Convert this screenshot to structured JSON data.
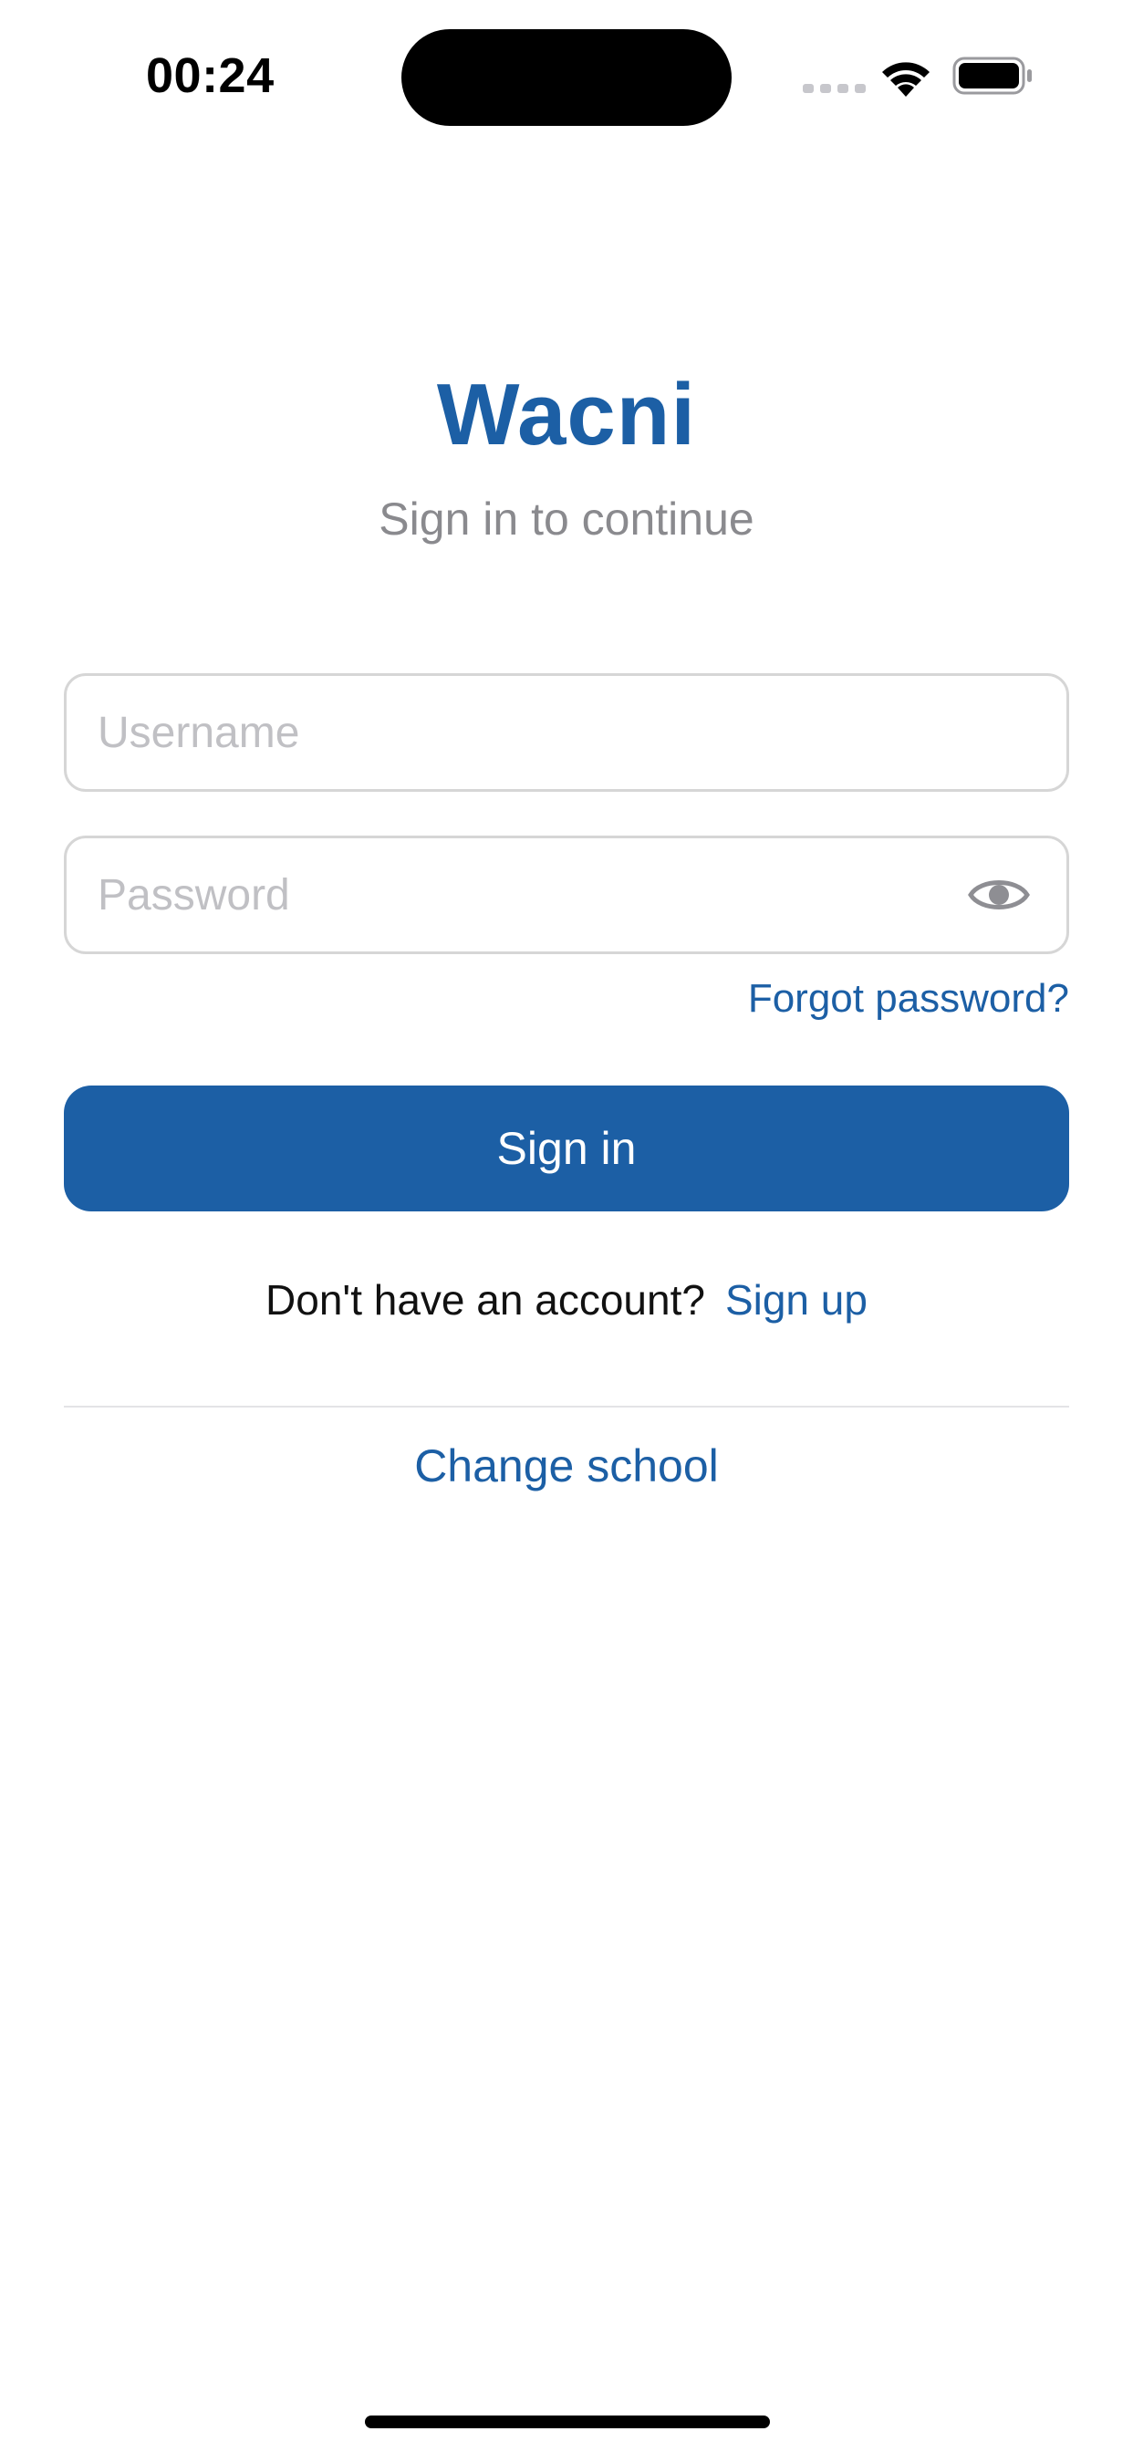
{
  "status_bar": {
    "time": "00:24",
    "icons": [
      "cellular-signal-icon",
      "wifi-icon",
      "battery-icon"
    ]
  },
  "header": {
    "title": "Wacni",
    "subtitle": "Sign in to continue"
  },
  "form": {
    "username_placeholder": "Username",
    "username_value": "",
    "password_placeholder": "Password",
    "password_value": "",
    "password_toggle_icon": "eye-icon",
    "forgot_password_label": "Forgot password?",
    "sign_in_label": "Sign in"
  },
  "signup": {
    "prompt": "Don't have an account?",
    "link_label": "Sign up"
  },
  "footer": {
    "change_school_label": "Change school"
  },
  "colors": {
    "accent": "#1c5fa5",
    "subtitle": "#8a8a8e",
    "placeholder": "#c0c0c4",
    "field_border": "#d6d6d6"
  }
}
